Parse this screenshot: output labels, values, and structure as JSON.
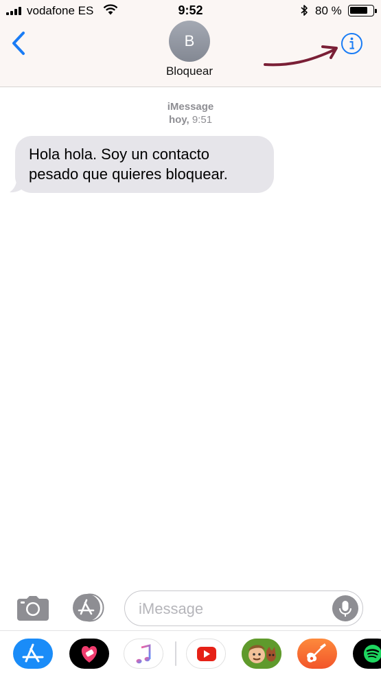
{
  "status_bar": {
    "carrier": "vodafone ES",
    "time": "9:52",
    "battery_percent": "80 %",
    "battery_level": 0.8
  },
  "nav": {
    "avatar_initial": "B",
    "contact_name": "Bloquear",
    "back_icon": "chevron-left-icon",
    "info_icon": "info-circle-icon",
    "annotation": "hand-drawn-arrow-pointing-to-info"
  },
  "conversation": {
    "service_label": "iMessage",
    "date_label": "hoy,",
    "time_label": "9:51",
    "messages": [
      {
        "direction": "incoming",
        "text": "Hola hola. Soy un contacto pesado que quieres bloquear."
      }
    ]
  },
  "compose": {
    "placeholder": "iMessage",
    "camera_icon": "camera-icon",
    "apps_icon": "app-store-icon",
    "mic_icon": "microphone-icon"
  },
  "app_drawer": {
    "apps": [
      {
        "name": "App Store",
        "icon": "app-store-icon"
      },
      {
        "name": "Digital Touch",
        "icon": "digital-touch-heart-icon"
      },
      {
        "name": "Music",
        "icon": "music-note-icon"
      },
      {
        "name": "YouTube",
        "icon": "youtube-icon"
      },
      {
        "name": "Gardenscapes",
        "icon": "game-character-icon"
      },
      {
        "name": "GarageBand",
        "icon": "guitar-icon"
      },
      {
        "name": "Spotify",
        "icon": "spotify-icon"
      }
    ]
  },
  "colors": {
    "accent": "#1a7cf5",
    "incoming_bubble": "#e6e5ea",
    "annotation_arrow": "#7a1f36",
    "youtube_red": "#e62117",
    "spotify_green": "#1ed760"
  }
}
